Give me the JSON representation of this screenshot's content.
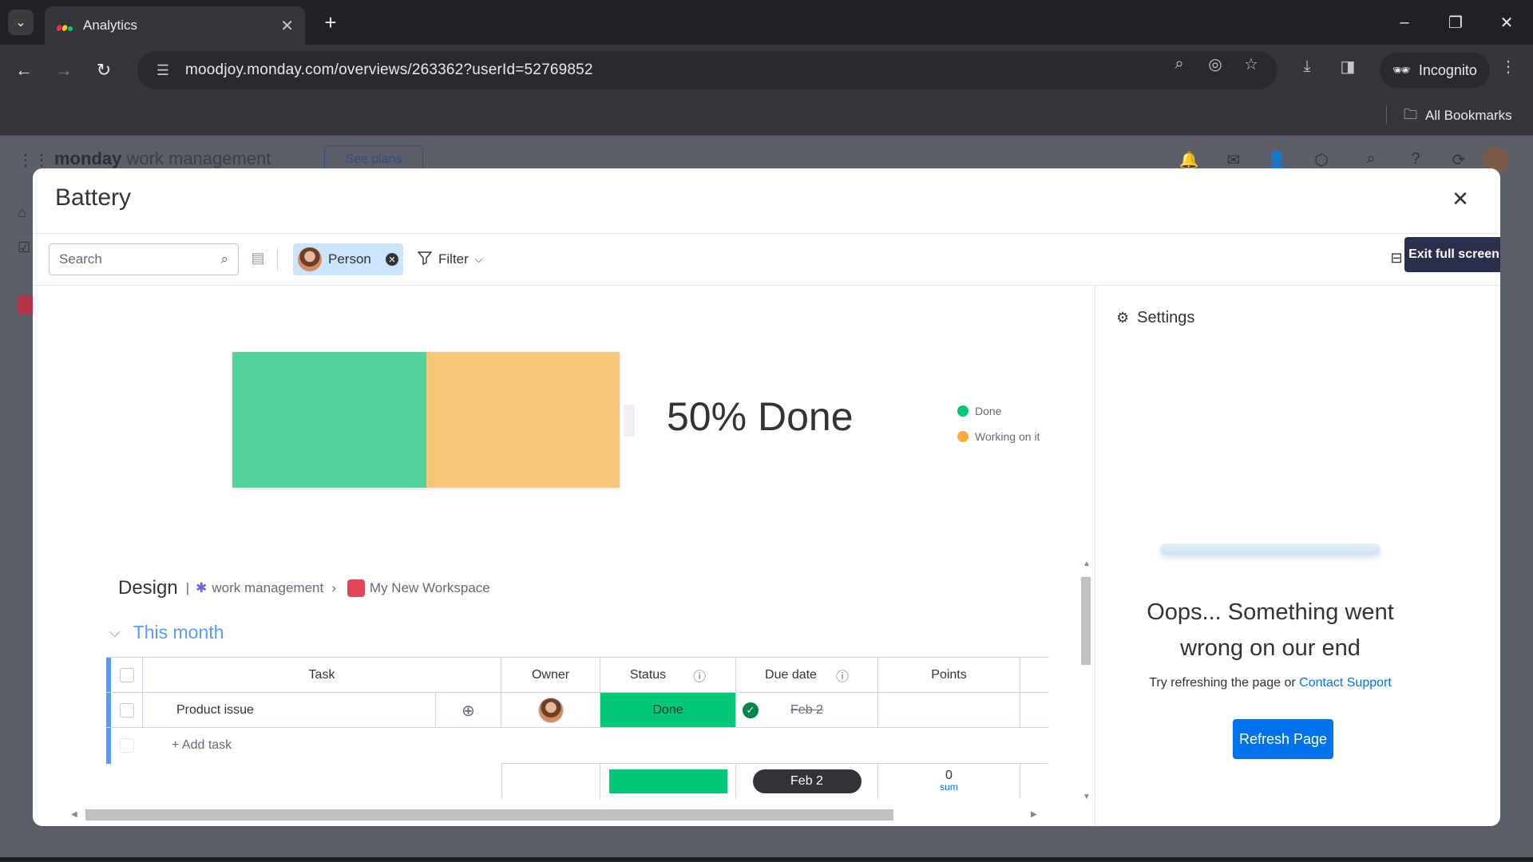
{
  "browser": {
    "tab_title": "Analytics",
    "url": "moodjoy.monday.com/overviews/263362?userId=52769852",
    "incognito_label": "Incognito",
    "bookmarks_label": "All Bookmarks"
  },
  "app": {
    "logo_brand": "monday",
    "logo_product": " work management",
    "see_plans": "See plans"
  },
  "modal": {
    "title": "Battery",
    "tooltip": "Exit full screen",
    "search_placeholder": "Search",
    "person_chip": "Person",
    "filter_label": "Filter"
  },
  "battery": {
    "done_fraction": 0.5,
    "working_fraction": 0.5,
    "done_color": "#52d39c",
    "working_color": "#f8c77a",
    "summary": "50% Done",
    "legend": [
      {
        "label": "Done",
        "color": "#00c875"
      },
      {
        "label": "Working on it",
        "color": "#fdab3d"
      }
    ]
  },
  "board": {
    "name": "Design",
    "separator": "|",
    "workspace_type": "work management",
    "workspace_name": "My New Workspace",
    "group_title": "This month",
    "columns": {
      "task": "Task",
      "owner": "Owner",
      "status": "Status",
      "due_date": "Due date",
      "points": "Points"
    },
    "rows": [
      {
        "task": "Product issue",
        "status": "Done",
        "due_date": "Feb 2"
      }
    ],
    "add_task": "+ Add task",
    "summary": {
      "due_date": "Feb 2",
      "points_value": "0",
      "points_label": "sum"
    }
  },
  "settings_panel": {
    "title": "Settings",
    "error_title": "Oops... Something went wrong on our end",
    "error_sub_prefix": "Try refreshing the page or ",
    "error_link": "Contact Support",
    "refresh_button": "Refresh Page"
  }
}
